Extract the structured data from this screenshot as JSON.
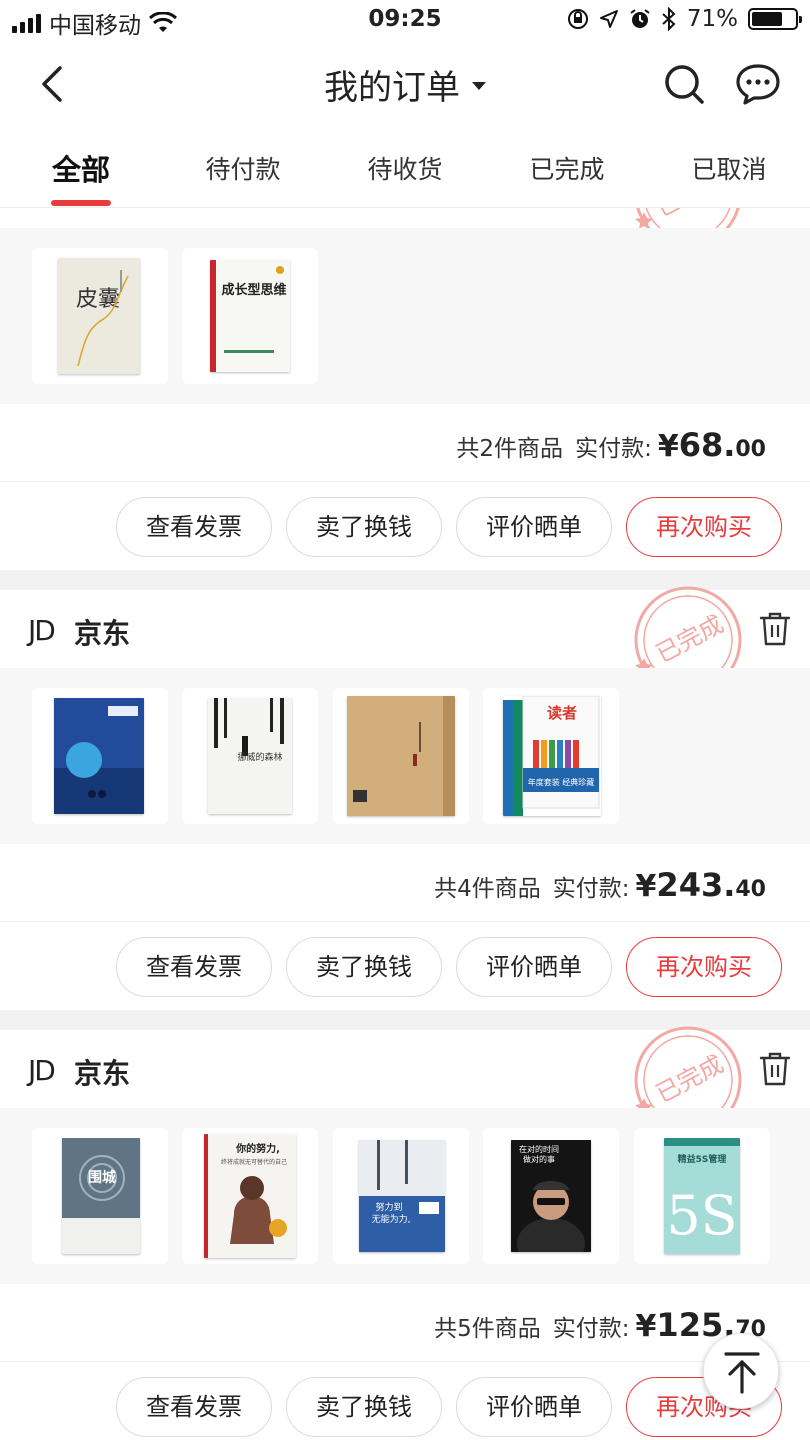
{
  "status_bar": {
    "carrier": "中国移动",
    "time": "09:25",
    "battery": "71%",
    "battery_level": 0.71
  },
  "nav": {
    "title": "我的订单",
    "icons": [
      "back-arrow",
      "search",
      "message"
    ]
  },
  "tabs": [
    {
      "label": "全部",
      "active": true
    },
    {
      "label": "待付款"
    },
    {
      "label": "待收货"
    },
    {
      "label": "已完成"
    },
    {
      "label": "已取消"
    }
  ],
  "colors": {
    "accent": "#e93b3d",
    "stamp": "#f2a9a3"
  },
  "orders": [
    {
      "stamp": "已完成",
      "summary": {
        "count": "共2件商品",
        "paid_label": "实付款:",
        "currency": "¥",
        "amount_int": "68.",
        "amount_dec": "00"
      },
      "actions": [
        "查看发票",
        "卖了换钱",
        "评价晒单",
        "再次购买"
      ],
      "items": [
        {
          "title": "皮囊"
        },
        {
          "title": "成长型思维"
        }
      ]
    },
    {
      "shop_logo": "JD",
      "shop": "京东",
      "stamp": "已完成",
      "summary": {
        "count": "共4件商品",
        "paid_label": "实付款:",
        "currency": "¥",
        "amount_int": "243.",
        "amount_dec": "40"
      },
      "actions": [
        "查看发票",
        "卖了换钱",
        "评价晒单",
        "再次购买"
      ],
      "items": [
        {
          "title": ""
        },
        {
          "title": "挪威的森林"
        },
        {
          "title": ""
        },
        {
          "title": "读者",
          "subtitle": "年度套装 经典珍藏"
        }
      ]
    },
    {
      "shop_logo": "JD",
      "shop": "京东",
      "stamp": "已完成",
      "summary": {
        "count": "共5件商品",
        "paid_label": "实付款:",
        "currency": "¥",
        "amount_int": "125.",
        "amount_dec": "70"
      },
      "actions": [
        "查看发票",
        "卖了换钱",
        "评价晒单",
        "再次购买"
      ],
      "items": [
        {
          "title": "围城"
        },
        {
          "title": "你的努力,",
          "subtitle": "终将成就无可替代的自己"
        },
        {
          "title": "努力到",
          "subtitle": "无能为力,"
        },
        {
          "title": "在对的时间",
          "subtitle": "做对的事"
        },
        {
          "title": "精益5S管理",
          "subtitle": "5S"
        }
      ]
    }
  ]
}
